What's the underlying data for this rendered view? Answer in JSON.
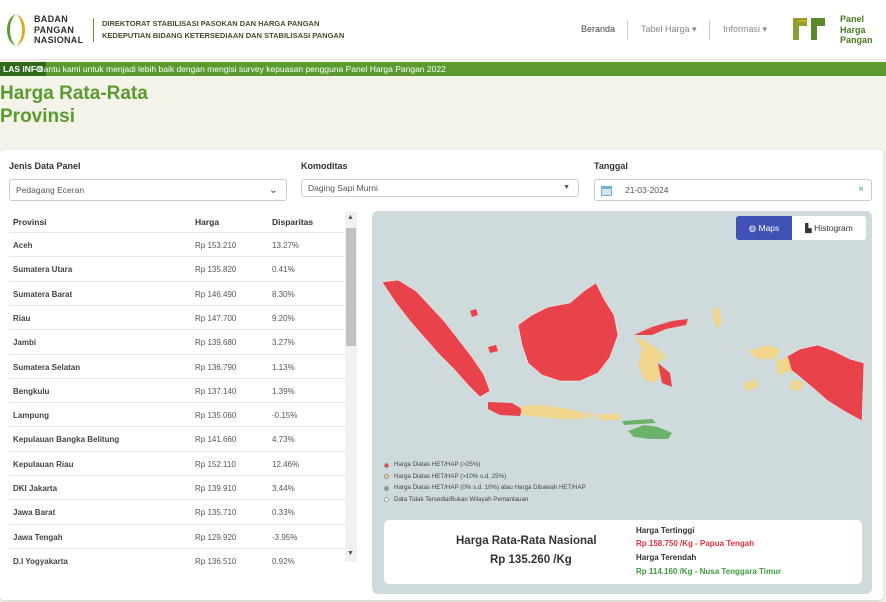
{
  "header": {
    "logo_lines": [
      "BADAN",
      "PANGAN",
      "NASIONAL"
    ],
    "directorate_lines": [
      "DIREKTORAT STABILISASI PASOKAN DAN HARGA PANGAN",
      "KEDEPUTIAN BIDANG KETERSEDIAAN DAN STABILISASI PANGAN"
    ],
    "nav": {
      "beranda": "Beranda",
      "tabel": "Tabel Harga",
      "informasi": "Informasi"
    },
    "panel_logo_lines": [
      "Panel",
      "Harga",
      "Pangan"
    ]
  },
  "infobar": {
    "label": "LAS INFO",
    "text": "Bantu kami untuk menjadi lebih baik dengan mengisi survey kepuasan pengguna Panel Harga Pangan 2022"
  },
  "title_lines": [
    "Harga Rata-Rata",
    "Provinsi"
  ],
  "filters": {
    "jenis_label": "Jenis Data Panel",
    "jenis_value": "Pedagang Eceran",
    "komoditas_label": "Komoditas",
    "komoditas_value": "Daging Sapi Murni",
    "tanggal_label": "Tanggal",
    "tanggal_value": "21-03-2024"
  },
  "table": {
    "headers": {
      "provinsi": "Provinsi",
      "harga": "Harga",
      "disparitas": "Disparitas"
    },
    "rows": [
      {
        "provinsi": "Aceh",
        "harga": "Rp 153.210",
        "disparitas": "13.27%"
      },
      {
        "provinsi": "Sumatera Utara",
        "harga": "Rp 135.820",
        "disparitas": "0.41%"
      },
      {
        "provinsi": "Sumatera Barat",
        "harga": "Rp 146.490",
        "disparitas": "8.30%"
      },
      {
        "provinsi": "Riau",
        "harga": "Rp 147.700",
        "disparitas": "9.20%"
      },
      {
        "provinsi": "Jambi",
        "harga": "Rp 139.680",
        "disparitas": "3.27%"
      },
      {
        "provinsi": "Sumatera Selatan",
        "harga": "Rp 136.790",
        "disparitas": "1.13%"
      },
      {
        "provinsi": "Bengkulu",
        "harga": "Rp 137.140",
        "disparitas": "1.39%"
      },
      {
        "provinsi": "Lampung",
        "harga": "Rp 135.060",
        "disparitas": "-0.15%"
      },
      {
        "provinsi": "Kepulauan Bangka Belitung",
        "harga": "Rp 141.660",
        "disparitas": "4.73%"
      },
      {
        "provinsi": "Kepulauan Riau",
        "harga": "Rp 152.110",
        "disparitas": "12.46%"
      },
      {
        "provinsi": "DKI Jakarta",
        "harga": "Rp 139.910",
        "disparitas": "3.44%"
      },
      {
        "provinsi": "Jawa Barat",
        "harga": "Rp 135.710",
        "disparitas": "0.33%"
      },
      {
        "provinsi": "Jawa Tengah",
        "harga": "Rp 129.920",
        "disparitas": "-3.95%"
      },
      {
        "provinsi": "D.I Yogyakarta",
        "harga": "Rp 136.510",
        "disparitas": "0.92%"
      }
    ]
  },
  "map": {
    "btn_maps": "Maps",
    "btn_histogram": "Histogram",
    "legend": [
      {
        "label": "Harga Diatas HET/HAP (>25%)",
        "color": "#e8434a"
      },
      {
        "label": "Harga Diatas HET/HAP (>10% s.d. 25%)",
        "color": "#f0d58c"
      },
      {
        "label": "Harga Diatas HET/HAP (0% s.d. 10%) atau Harga Dibawah HET/HAP",
        "color": "#6ab26a"
      },
      {
        "label": "Data Tidak Tersedia/Bukan Wilayah Pemantauan",
        "color": "#ffffff"
      }
    ],
    "colors": {
      "red": "#e8434a",
      "yellow": "#f0d58c",
      "green": "#6ab26a",
      "sea": "#cfdadc"
    }
  },
  "summary": {
    "title": "Harga Rata-Rata Nasional",
    "value": "Rp 135.260 /Kg",
    "highest_label": "Harga Tertinggi",
    "highest_value": "Rp 158.750 /Kg - Papua Tengah",
    "lowest_label": "Harga Terendah",
    "lowest_value": "Rp 114.160 /Kg - Nusa Tenggara Timur"
  }
}
